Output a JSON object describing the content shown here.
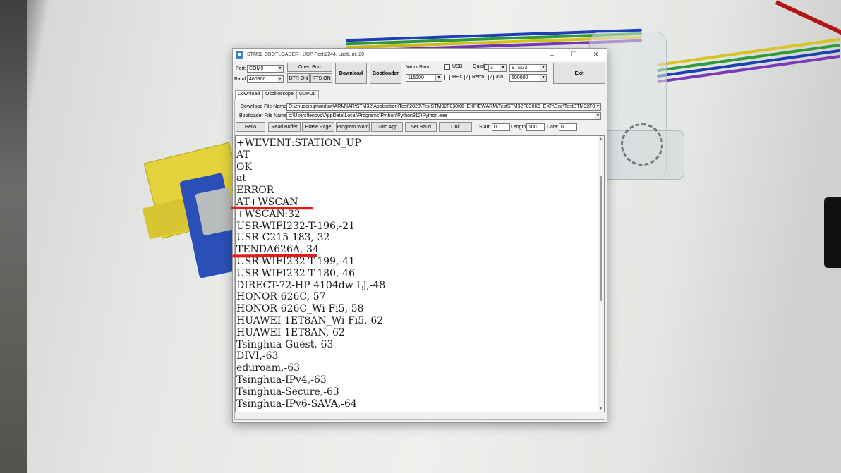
{
  "window": {
    "title": "STM32 BOOTLOADER : UDP Port:2244, LastLine:20",
    "min": "–",
    "max": "☐",
    "close": "✕"
  },
  "toolbar": {
    "port_label": "Port:",
    "port_value": "COM9",
    "baud_label": "Baud:",
    "baud_value": "460800",
    "open_port": "Open Port",
    "dtr_on": "DTR ON",
    "rts_on": "RTS ON",
    "download": "Download",
    "bootloader": "Bootloader",
    "work_baud_label": "Work Baud:",
    "work_baud_value": "115200",
    "usb_label": "USB",
    "quick_label": "Quick",
    "quick_value": "3",
    "hex_label": "HEX",
    "retrn_label": "Retrn",
    "rn_label": "/r/n",
    "chip_value": "STM32",
    "second_baud_value": "500000",
    "exit": "Exit",
    "check": "✓"
  },
  "tabs": [
    {
      "label": "Download"
    },
    {
      "label": "Oscilloscope"
    },
    {
      "label": "UDPDL"
    }
  ],
  "files": {
    "download_label": "Download File Name:",
    "download_value": "D:\\zhuoqing\\window\\ARM\\IAR\\STM32\\Application\\Test\\2023\\TestSTM32F030K6_EXP\\EWARM\\TestSTM32F030K6_EXP\\Exe\\TestSTM32F0",
    "bootloader_label": "Bootloader File Name:",
    "bootloader_value": "c:\\Users\\lenovo\\AppData\\Local\\Programs\\Python\\Python312\\Python.exe"
  },
  "actions": {
    "hello": "Hello",
    "read_buffer": "Read Buffer",
    "erase_page": "Erase Page",
    "program_word": "Program Word",
    "goto_app": "Goto App",
    "set_baud": "Set Baud",
    "link": "Link",
    "start_label": "Start:",
    "start_value": "0",
    "length_label": "Length:",
    "length_value": "100",
    "data_label": "Data:",
    "data_value": "0"
  },
  "console": {
    "lines": [
      "+WEVENT:STATION_UP",
      "AT",
      "OK",
      "at",
      "ERROR",
      "AT+WSCAN",
      "+WSCAN:32",
      "USR-WIFI232-T-196,-21",
      "USR-C215-183,-32",
      "TENDA626A,-34",
      "USR-WIFI232-T-199,-41",
      "USR-WIFI232-T-180,-46",
      "DIRECT-72-HP 4104dw LJ,-48",
      "HONOR-626C,-57",
      "HONOR-626C_Wi-Fi5,-58",
      "HUAWEI-1ET8AN_Wi-Fi5,-62",
      "HUAWEI-1ET8AN,-62",
      "Tsinghua-Guest,-63",
      "DIVI,-63",
      "eduroam,-63",
      "Tsinghua-IPv4,-63",
      "Tsinghua-Secure,-63",
      "Tsinghua-IPv6-SAVA,-64"
    ]
  },
  "colors": {
    "highlight": "#e41b1b"
  }
}
